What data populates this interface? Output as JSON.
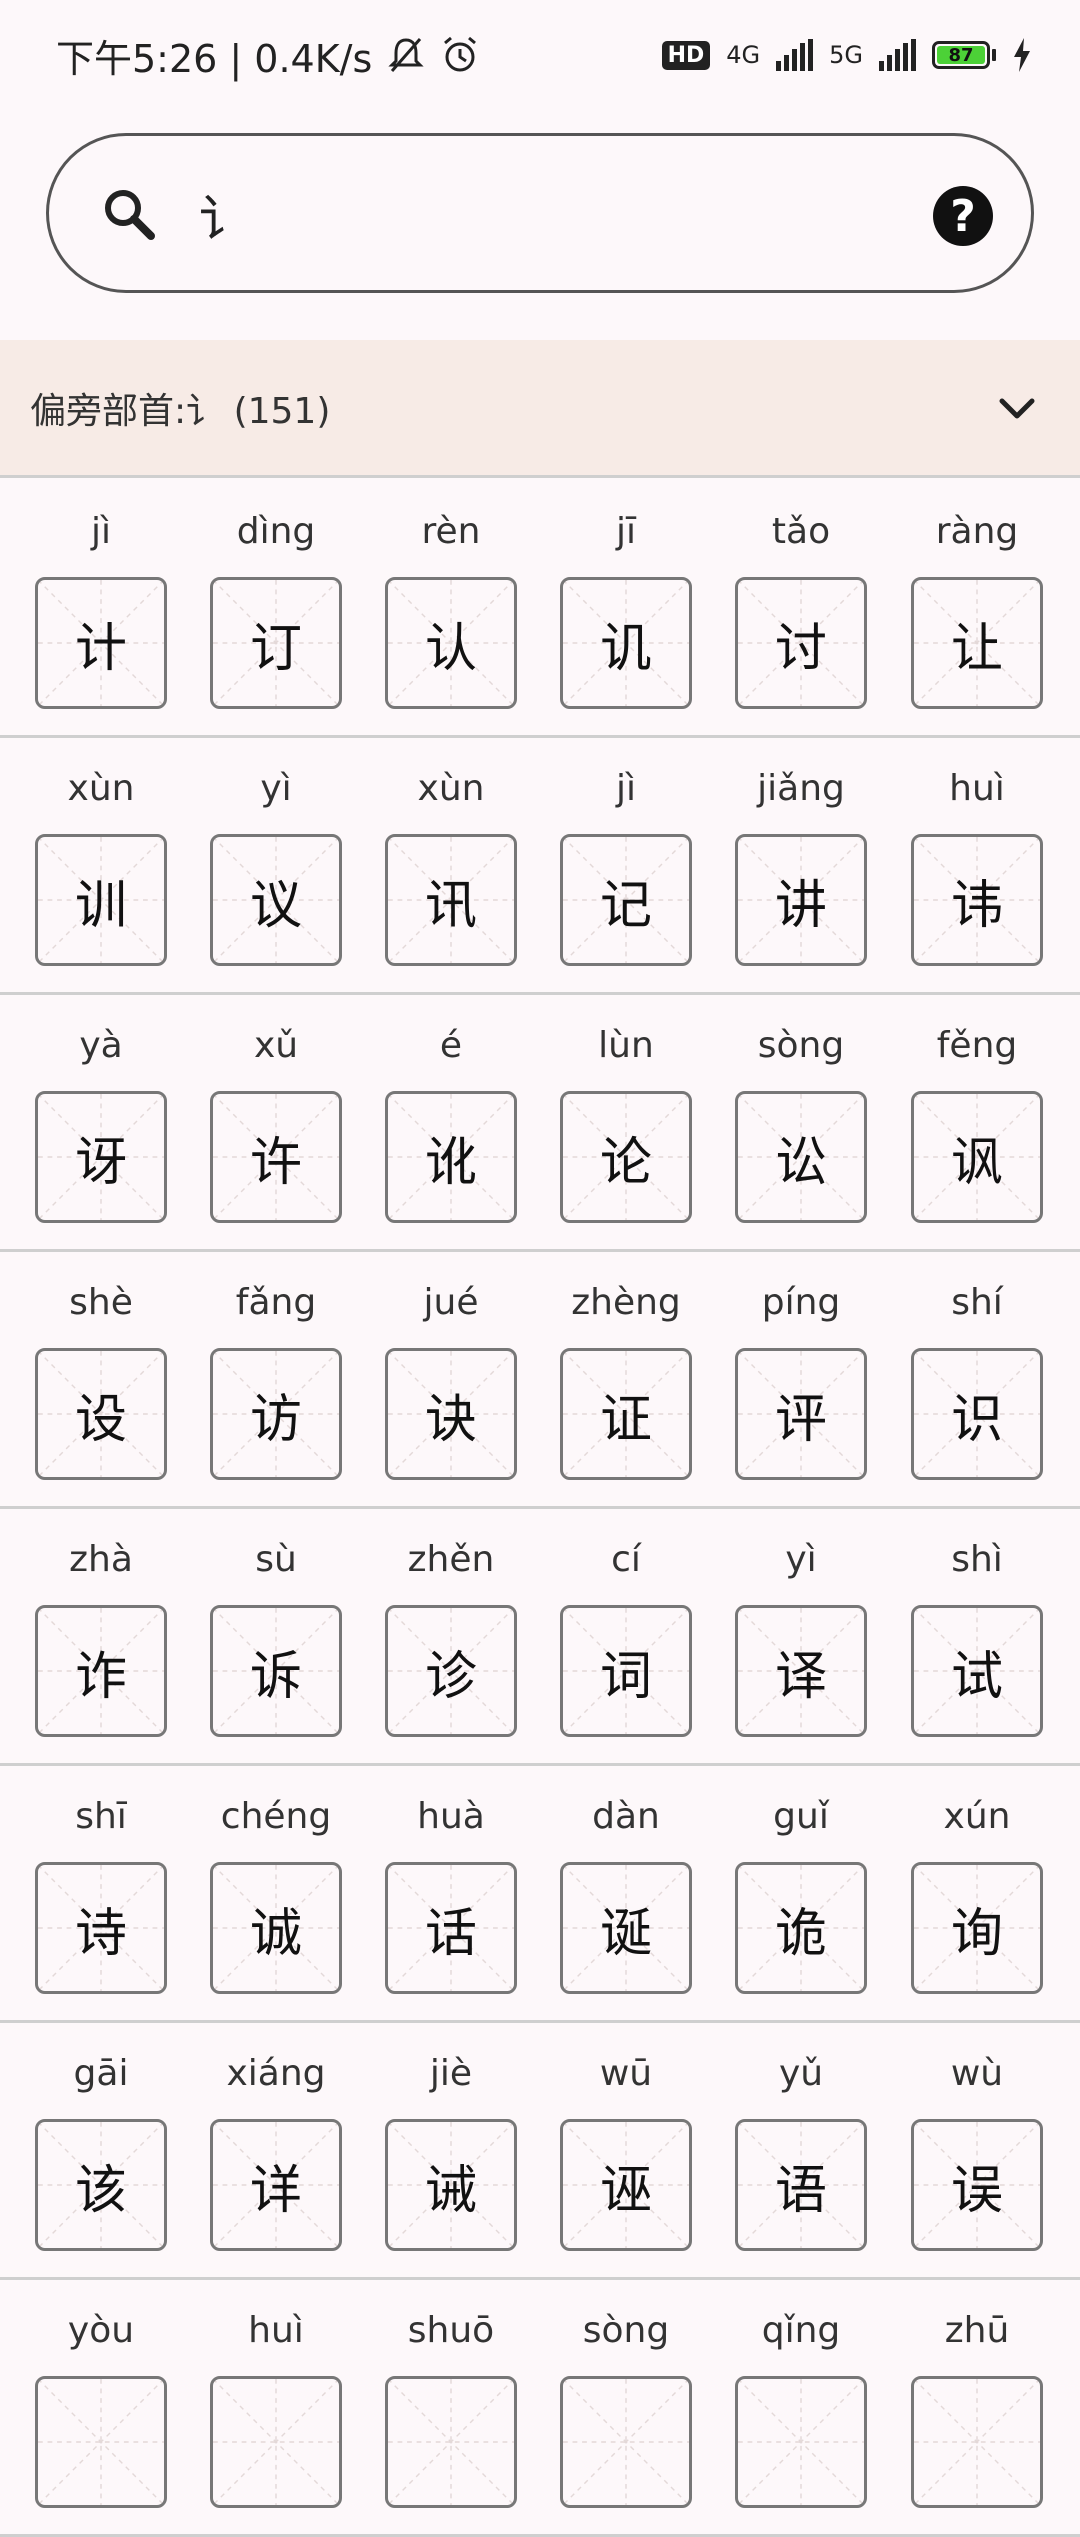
{
  "status_bar": {
    "time_speed": "下午5:26 | 0.4K/s",
    "hd_label": "HD",
    "net1": "4G",
    "net2": "5G",
    "battery": "87",
    "icons": [
      "mute-bell-icon",
      "alarm-icon",
      "signal-icon",
      "battery-icon",
      "charging-icon"
    ]
  },
  "search": {
    "value": "讠",
    "placeholder": ""
  },
  "radical": {
    "title": "偏旁部首:讠 (151)"
  },
  "rows": [
    [
      {
        "py": "jì",
        "ch": "计"
      },
      {
        "py": "dìng",
        "ch": "订"
      },
      {
        "py": "rèn",
        "ch": "认"
      },
      {
        "py": "jī",
        "ch": "讥"
      },
      {
        "py": "tǎo",
        "ch": "讨"
      },
      {
        "py": "ràng",
        "ch": "让"
      }
    ],
    [
      {
        "py": "xùn",
        "ch": "训"
      },
      {
        "py": "yì",
        "ch": "议"
      },
      {
        "py": "xùn",
        "ch": "讯"
      },
      {
        "py": "jì",
        "ch": "记"
      },
      {
        "py": "jiǎng",
        "ch": "讲"
      },
      {
        "py": "huì",
        "ch": "讳"
      }
    ],
    [
      {
        "py": "yà",
        "ch": "讶"
      },
      {
        "py": "xǔ",
        "ch": "许"
      },
      {
        "py": "é",
        "ch": "讹"
      },
      {
        "py": "lùn",
        "ch": "论"
      },
      {
        "py": "sòng",
        "ch": "讼"
      },
      {
        "py": "fěng",
        "ch": "讽"
      }
    ],
    [
      {
        "py": "shè",
        "ch": "设"
      },
      {
        "py": "fǎng",
        "ch": "访"
      },
      {
        "py": "jué",
        "ch": "诀"
      },
      {
        "py": "zhèng",
        "ch": "证"
      },
      {
        "py": "píng",
        "ch": "评"
      },
      {
        "py": "shí",
        "ch": "识"
      }
    ],
    [
      {
        "py": "zhà",
        "ch": "诈"
      },
      {
        "py": "sù",
        "ch": "诉"
      },
      {
        "py": "zhěn",
        "ch": "诊"
      },
      {
        "py": "cí",
        "ch": "词"
      },
      {
        "py": "yì",
        "ch": "译"
      },
      {
        "py": "shì",
        "ch": "试"
      }
    ],
    [
      {
        "py": "shī",
        "ch": "诗"
      },
      {
        "py": "chéng",
        "ch": "诚"
      },
      {
        "py": "huà",
        "ch": "话"
      },
      {
        "py": "dàn",
        "ch": "诞"
      },
      {
        "py": "guǐ",
        "ch": "诡"
      },
      {
        "py": "xún",
        "ch": "询"
      }
    ],
    [
      {
        "py": "gāi",
        "ch": "该"
      },
      {
        "py": "xiáng",
        "ch": "详"
      },
      {
        "py": "jiè",
        "ch": "诫"
      },
      {
        "py": "wū",
        "ch": "诬"
      },
      {
        "py": "yǔ",
        "ch": "语"
      },
      {
        "py": "wù",
        "ch": "误"
      }
    ],
    [
      {
        "py": "yòu",
        "ch": ""
      },
      {
        "py": "huì",
        "ch": ""
      },
      {
        "py": "shuō",
        "ch": ""
      },
      {
        "py": "sòng",
        "ch": ""
      },
      {
        "py": "qǐng",
        "ch": ""
      },
      {
        "py": "zhū",
        "ch": ""
      }
    ]
  ]
}
